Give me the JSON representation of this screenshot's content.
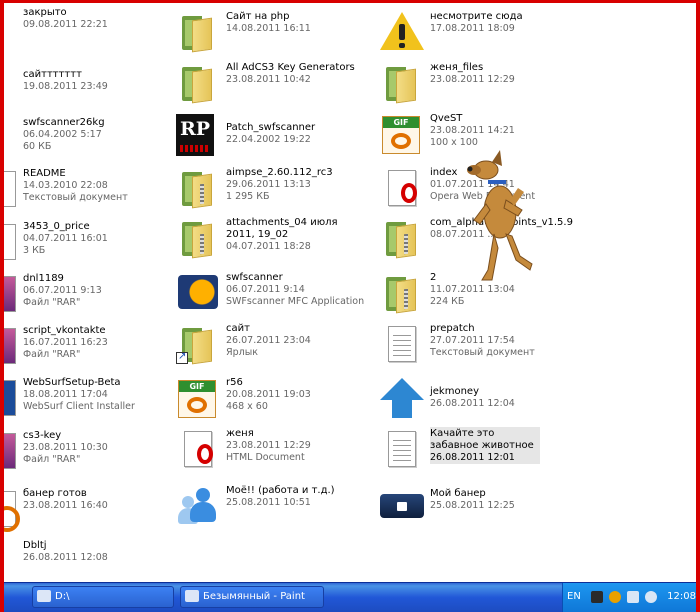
{
  "desktop": {
    "col0": [
      {
        "name": "закрыто",
        "m1": "09.08.2011 22:21",
        "m2": ""
      },
      {
        "name": "сайттттттт",
        "m1": "19.08.2011 23:49",
        "m2": ""
      },
      {
        "name": "swfscanner26kg",
        "m1": "06.04.2002 5:17",
        "m2": "60 КБ"
      },
      {
        "name": "README",
        "m1": "14.03.2010 22:08",
        "m2": "Текстовый документ"
      },
      {
        "name": "3453_0_price",
        "m1": "04.07.2011 16:01",
        "m2": "3 КБ"
      },
      {
        "name": "dnl1189",
        "m1": "06.07.2011 9:13",
        "m2": "Файл \"RAR\""
      },
      {
        "name": "script_vkontakte",
        "m1": "16.07.2011 16:23",
        "m2": "Файл \"RAR\""
      },
      {
        "name": "WebSurfSetup-Beta",
        "m1": "18.08.2011 17:04",
        "m2": "WebSurf Client Installer"
      },
      {
        "name": "cs3-key",
        "m1": "23.08.2011 10:30",
        "m2": "Файл \"RAR\""
      },
      {
        "name": "банер готов",
        "m1": "23.08.2011 16:40",
        "m2": ""
      },
      {
        "name": "Dbltj",
        "m1": "26.08.2011 12:08",
        "m2": ""
      }
    ],
    "col1": [
      {
        "name": "Сайт на php",
        "m1": "14.08.2011 16:11",
        "m2": ""
      },
      {
        "name": "All AdCS3 Key Generators",
        "m1": "23.08.2011 10:42",
        "m2": ""
      },
      {
        "name": "Patch_swfscanner",
        "m1": "22.04.2002 19:22",
        "m2": ""
      },
      {
        "name": "aimpse_2.60.112_rc3",
        "m1": "29.06.2011 13:13",
        "m2": "1 295 КБ"
      },
      {
        "name": "attachments_04 июля 2011, 19_02",
        "m1": "04.07.2011 18:28",
        "m2": ""
      },
      {
        "name": "swfscanner",
        "m1": "06.07.2011 9:14",
        "m2": "SWFscanner MFC Application"
      },
      {
        "name": "сайт",
        "m1": "26.07.2011 23:04",
        "m2": "Ярлык"
      },
      {
        "name": "r56",
        "m1": "20.08.2011 19:03",
        "m2": "468 x 60"
      },
      {
        "name": "женя",
        "m1": "23.08.2011 12:29",
        "m2": "HTML Document"
      },
      {
        "name": "Моё!! (работа и т.д.)",
        "m1": "25.08.2011 10:51",
        "m2": ""
      }
    ],
    "col2": [
      {
        "name": "несмотрите сюда",
        "m1": "17.08.2011 18:09",
        "m2": ""
      },
      {
        "name": "женя_files",
        "m1": "23.08.2011 12:29",
        "m2": ""
      },
      {
        "name": "QveST",
        "m1": "23.08.2011 14:21",
        "m2": "100 x 100"
      },
      {
        "name": "index",
        "m1": "01.07.2011 14:41",
        "m2": "Opera Web Document"
      },
      {
        "name": "com_alphauserpoints_v1.5.9",
        "m1": "08.07.2011 ...7",
        "m2": ""
      },
      {
        "name": "2",
        "m1": "11.07.2011 13:04",
        "m2": "224 КБ"
      },
      {
        "name": "prepatch",
        "m1": "27.07.2011 17:54",
        "m2": "Текстовый документ"
      },
      {
        "name": "jekmoney",
        "m1": "26.08.2011 12:04",
        "m2": ""
      },
      {
        "name": "Качайте это забавное животное",
        "m1": "26.08.2011 12:01",
        "m2": ""
      },
      {
        "name": "Мой банер",
        "m1": "25.08.2011 12:25",
        "m2": ""
      }
    ]
  },
  "taskbar": {
    "items": [
      {
        "label": "D:\\"
      },
      {
        "label": "Безымянный - Paint"
      }
    ],
    "lang": "EN",
    "clock": "12:08"
  },
  "icons": {
    "folder": "folder-icon",
    "zip": "zip-folder-icon",
    "text": "text-document-icon",
    "opera": "opera-document-icon",
    "gif": "gif-image-icon",
    "warning": "warning-icon",
    "app": "application-icon"
  }
}
